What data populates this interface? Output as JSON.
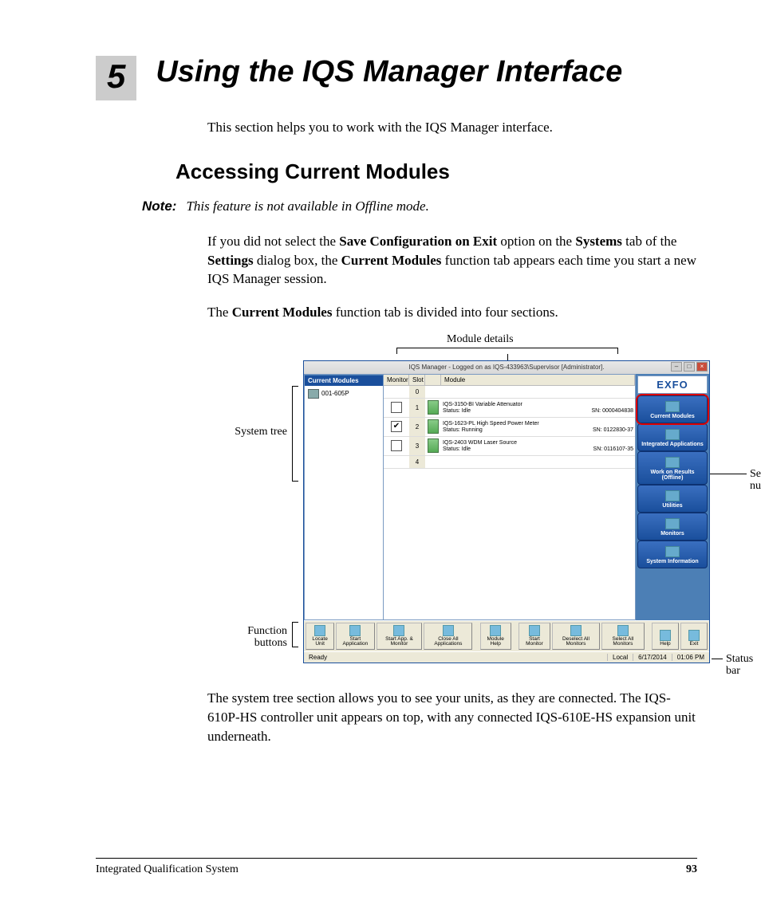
{
  "chapter": {
    "number": "5",
    "title": "Using the IQS Manager Interface"
  },
  "intro": "This section helps you to work with the IQS Manager interface.",
  "h2": "Accessing Current Modules",
  "note": {
    "label": "Note:",
    "text": "This feature is not available in Offline mode."
  },
  "para1": {
    "a": "If you did not select the ",
    "b": "Save Configuration on Exit",
    "c": " option on the ",
    "d": "Systems",
    "e": " tab of the ",
    "f": "Settings",
    "g": " dialog box, the ",
    "h": "Current Modules",
    "i": " function tab appears each time you start a new IQS Manager session."
  },
  "para2": {
    "a": "The ",
    "b": "Current Modules",
    "c": " function tab is divided into four sections."
  },
  "callouts": {
    "module_details": "Module details",
    "system_tree": "System tree",
    "function_buttons_l1": "Function",
    "function_buttons_l2": "buttons",
    "serial_number_l1": "Serial",
    "serial_number_l2": "number",
    "status_bar": "Status bar"
  },
  "screenshot": {
    "title": "IQS Manager - Logged on as IQS-433963\\Supervisor [Administrator].",
    "tree_header": "Current Modules",
    "tree_item": "001-605P",
    "logo": "EXFO",
    "columns": {
      "monitor": "Monitor",
      "slot": "Slot",
      "module": "Module"
    },
    "rows": [
      {
        "slot": "0",
        "empty": true
      },
      {
        "slot": "1",
        "name": "IQS-3150-BI Variable Attenuator",
        "status": "Status: Idle",
        "sn": "SN: 0000404838",
        "checked": false
      },
      {
        "slot": "2",
        "name": "IQS-1623-PL High Speed Power Meter",
        "status": "Status: Running",
        "sn": "SN: 0122830-37",
        "checked": true
      },
      {
        "slot": "3",
        "name": "IQS-2403 WDM Laser Source",
        "status": "Status: Idle",
        "sn": "SN: 0116107-35",
        "checked": false
      },
      {
        "slot": "4",
        "empty": true
      }
    ],
    "nav": [
      "Current Modules",
      "Integrated Applications",
      "Work on Results (Offline)",
      "Utilities",
      "Monitors",
      "System Information"
    ],
    "toolbar": [
      "Locate Unit",
      "Start Application",
      "Start App. & Monitor",
      "Close All Applications",
      "Module Help",
      "Start Monitor",
      "Deselect All Monitors",
      "Select All Monitors",
      "Help",
      "Exit"
    ],
    "status": {
      "ready": "Ready",
      "local": "Local",
      "date": "6/17/2014",
      "time": "01:06 PM"
    }
  },
  "para3": "The system tree section allows you to see your units, as they are connected. The IQS-610P-HS controller unit appears on top, with any connected IQS-610E-HS expansion unit underneath.",
  "footer": {
    "doc": "Integrated Qualification System",
    "page": "93"
  }
}
